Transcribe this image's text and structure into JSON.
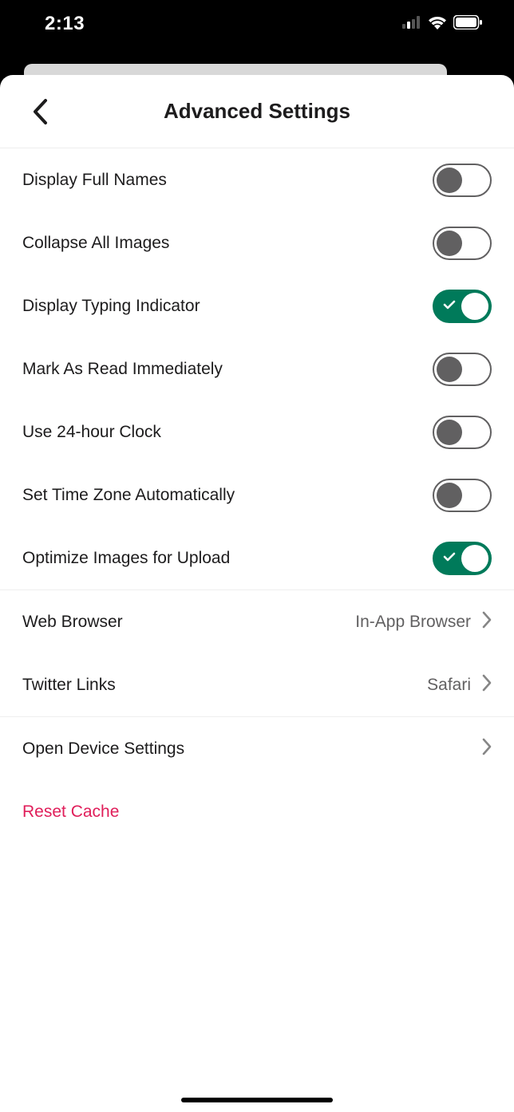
{
  "status": {
    "time": "2:13"
  },
  "header": {
    "title": "Advanced Settings"
  },
  "toggles": [
    {
      "label": "Display Full Names",
      "on": false
    },
    {
      "label": "Collapse All Images",
      "on": false
    },
    {
      "label": "Display Typing Indicator",
      "on": true
    },
    {
      "label": "Mark As Read Immediately",
      "on": false
    },
    {
      "label": "Use 24-hour Clock",
      "on": false
    },
    {
      "label": "Set Time Zone Automatically",
      "on": false
    },
    {
      "label": "Optimize Images for Upload",
      "on": true
    }
  ],
  "navRows": [
    {
      "label": "Web Browser",
      "value": "In-App Browser"
    },
    {
      "label": "Twitter Links",
      "value": "Safari"
    }
  ],
  "actions": {
    "deviceSettings": "Open Device Settings",
    "resetCache": "Reset Cache"
  },
  "colors": {
    "accent": "#007a5a",
    "danger": "#e01e5a",
    "toggleOffKnob": "#616061"
  }
}
